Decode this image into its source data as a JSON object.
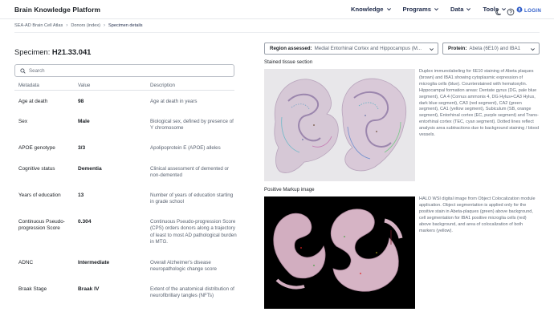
{
  "header": {
    "brand": "Brain Knowledge Platform",
    "nav": [
      {
        "label": "Knowledge",
        "icon": "chevron-down-icon"
      },
      {
        "label": "Programs",
        "icon": "chevron-down-icon"
      },
      {
        "label": "Data",
        "icon": "chevron-down-icon"
      },
      {
        "label": "Tools",
        "icon": "chevron-down-icon"
      }
    ],
    "icons": [
      "moon-icon",
      "help-icon",
      "user-icon"
    ],
    "login_label": "LOGIN"
  },
  "breadcrumb": {
    "items": [
      "SEA-AD Brain Cell Atlas",
      "Donors (index)",
      "Specimen details"
    ]
  },
  "specimen": {
    "prefix": "Specimen:",
    "id": "H21.33.041"
  },
  "search": {
    "placeholder": "Search"
  },
  "table": {
    "headers": [
      "Metadata",
      "Value",
      "Description"
    ],
    "rows": [
      {
        "metadata": "Age at death",
        "value": "98",
        "description": "Age at death in years"
      },
      {
        "metadata": "Sex",
        "value": "Male",
        "description": "Biological sex, defined by presence of Y chromosome"
      },
      {
        "metadata": "APOE genotype",
        "value": "3/3",
        "description": "Apolipoprotein E (APOE) alleles"
      },
      {
        "metadata": "Cognitive status",
        "value": "Dementia",
        "description": "Clinical assessment of demented or non-demented"
      },
      {
        "metadata": "Years of education",
        "value": "13",
        "description": "Number of years of education starting in grade school"
      },
      {
        "metadata": "Continuous Pseudo-progression Score",
        "value": "0.304",
        "description": "Continuous Pseudo-progression Score (CPS) orders donors along a trajectory of least to most AD pathological burden in MTG."
      },
      {
        "metadata": "ADNC",
        "value": "Intermediate",
        "description": "Overall Alzheimer's disease neuropathologic change score"
      },
      {
        "metadata": "Braak Stage",
        "value": "Braak IV",
        "description": "Extent of the anatomical distribution of neurofibrillary tangles (NFTs)"
      }
    ]
  },
  "selectors": {
    "region_label": "Region assessed:",
    "region_value": "Medial Entorhinal Cortex and Hippocampus (M...",
    "protein_label": "Protein:",
    "protein_value": "Abeta (6E10) and IBA1"
  },
  "sections": [
    {
      "title": "Stained tissue section",
      "caption": "Duplex immunolabeling for 6E10 staining of Abeta plaques (brown) and IBA1 showing cytoplasmic expression of microglia cells (blue). Counterstained with hematoxylin. Hippocampal formation areas: Dentate gyrus (DG, pale blue segment), CA 4 (Cornus ammonis 4, DG Hylus+CA3 Hylus, dark blue segment), CA3 (red segment), CA2 (green segment), CA1 (yellow segment), Subiculum (SB, orange segment), Entorhinal cortex (EC, purple segment) and Trans-entorhinal cortex (TEC, cyan segment). Dotted lines reflect analysis area subtractions due to background staining / blood vessels."
    },
    {
      "title": "Positive Markup image",
      "caption": "HALO  WSI digital image from Object Colocalization module application.  Object  segmentation is applied only for the positive stain in Abeta-plaques  (green) above background, cell segmentation for IBA1 positive microglia  cells (red) above background, and area of colocalization of both markers  (yellow)."
    }
  ],
  "colors": {
    "brand_text": "#1b1f24",
    "nav_text": "#1e2a4a",
    "login_accent": "#2f5dc9",
    "tissue_pink": "#d9b9c7",
    "markup_background": "#000000"
  }
}
